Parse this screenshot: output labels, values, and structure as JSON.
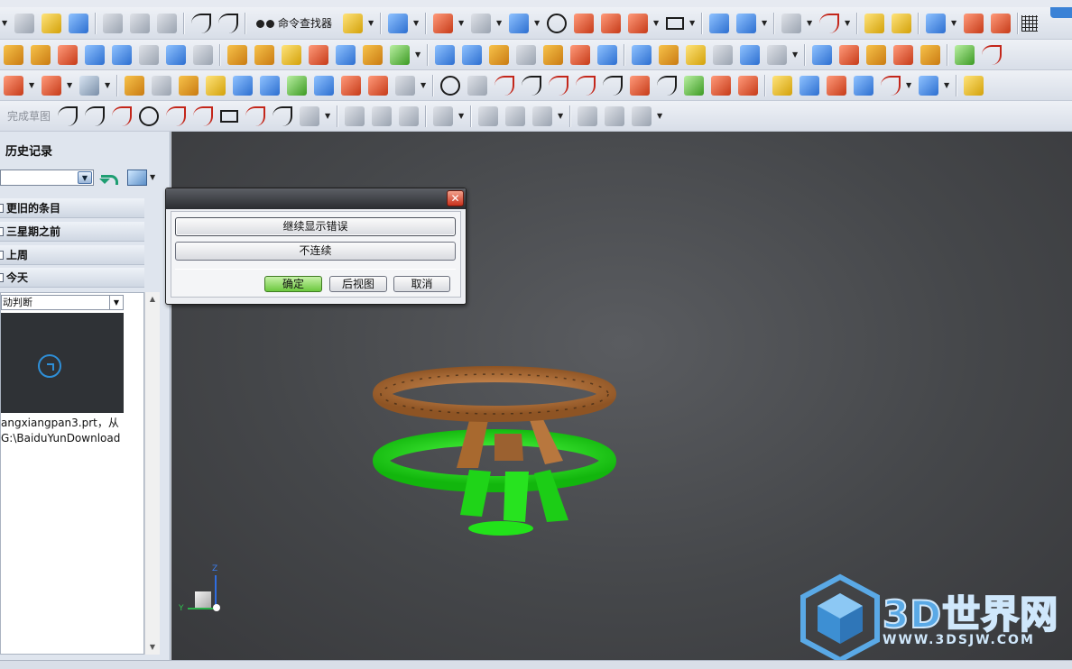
{
  "toolbar": {
    "command_finder_label": "命令查找器",
    "finish_sketch_label": "完成草图"
  },
  "history_panel": {
    "title": "历史记录",
    "groups": [
      "更旧的条目",
      "三星期之前",
      "上周",
      "今天"
    ],
    "filter_value": "动判断",
    "file_line_1": "angxiangpan3.prt，从",
    "file_line_2": "G:\\BaiduYunDownload"
  },
  "dialog": {
    "option_continue_errors": "继续显示错误",
    "option_discontinuous": "不连续",
    "ok_label": "确定",
    "back_view_label": "后视图",
    "cancel_label": "取消",
    "close_glyph": "✕"
  },
  "viewport": {
    "triad_z": "Z",
    "triad_y": "Y",
    "colors": {
      "top_wheel": "#b8773e",
      "bottom_wheel": "#22e21a",
      "background": "#45474a"
    }
  },
  "watermark": {
    "brand": "3D世界网",
    "url": "WWW.3DSJW.COM"
  },
  "icons": [
    "new-file-icon",
    "open-folder-icon",
    "save-icon",
    "cut-icon",
    "copy-icon",
    "paste-icon",
    "undo-icon",
    "redo-icon",
    "binoculars-icon",
    "grid-icon",
    "line-icon",
    "arc-icon",
    "circle-icon",
    "rectangle-icon"
  ]
}
